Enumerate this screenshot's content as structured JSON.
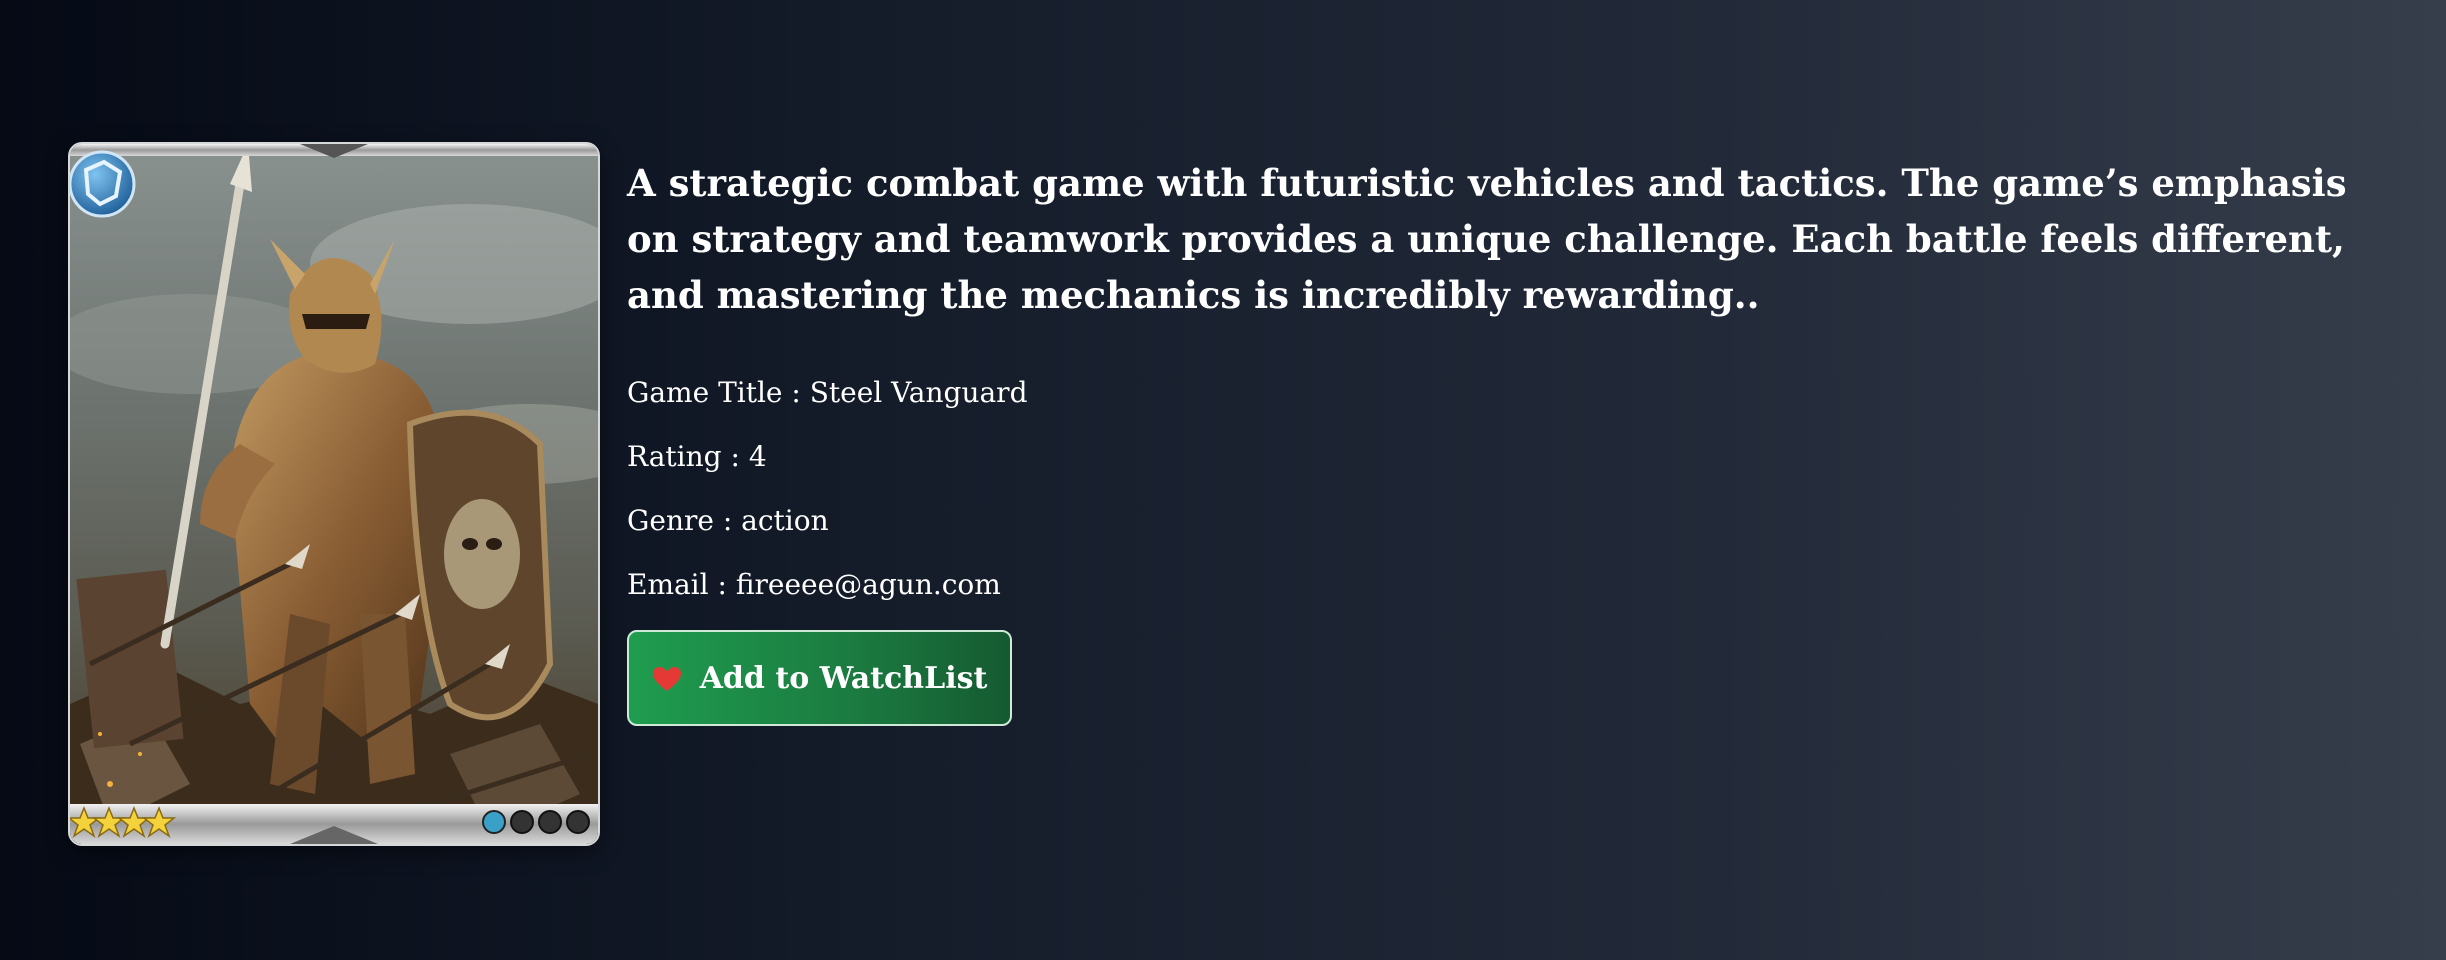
{
  "game": {
    "description": "A strategic combat game with futuristic vehicles and tactics. The game’s emphasis on strategy and teamwork provides a unique challenge. Each battle feels different, and mastering the mechanics is incredibly rewarding..",
    "title_line": "Game Title : Steel Vanguard",
    "rating_line": "Rating : 4",
    "genre_line": "Genre : action",
    "email_line": "Email : fireeee@agun.com"
  },
  "card": {
    "image_alt": "armored warrior card art",
    "star_count": 4
  },
  "watchlist_button": {
    "label": "Add to WatchList",
    "icon": "heart-icon",
    "icon_color": "#e53935"
  }
}
